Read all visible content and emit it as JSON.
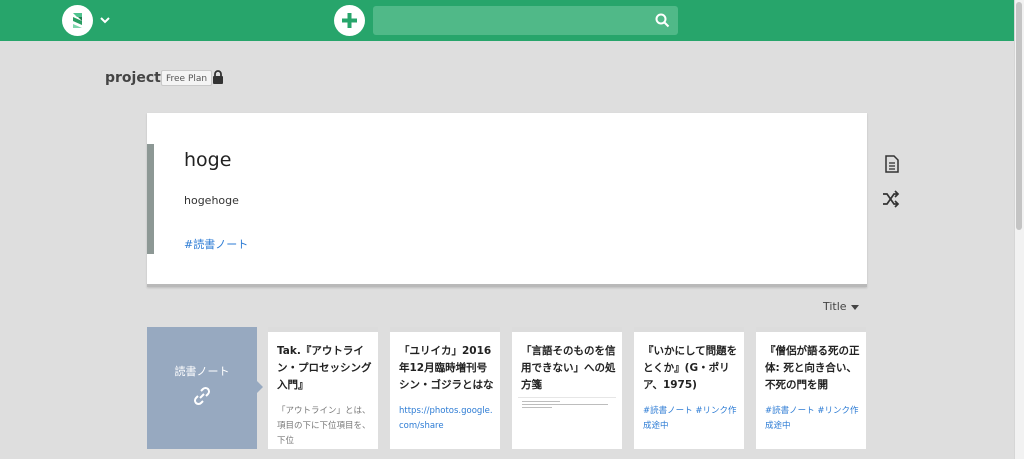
{
  "header": {
    "search": {
      "placeholder": "",
      "value": ""
    },
    "colors": {
      "bar": "#27a56b",
      "search_bg": "#50b988"
    }
  },
  "project": {
    "name": "project",
    "plan": "Free Plan"
  },
  "page": {
    "title": "hoge",
    "body": "hogehoge",
    "tag": "#読書ノート"
  },
  "sort": {
    "label": "Title"
  },
  "tag_tile": {
    "label": "読書ノート"
  },
  "cards": [
    {
      "title": "Tak.『アウトライン・プロセッシング入門』",
      "desc": "「アウトライン」とは、項目の下に下位項目を、下位"
    },
    {
      "title": "「ユリイカ」2016年12月臨時増刊号 シン・ゴジラとはな",
      "link": "https://photos.google.com/share"
    },
    {
      "title": "「言語そのものを信用できない」への処方箋"
    },
    {
      "title": "『いかにして問題をとくか』(G・ポリア、1975)",
      "tags": "#読書ノート #リンク作成途中"
    },
    {
      "title": "『僧侶が語る死の正体: 死と向き合い、不死の門を開",
      "tags": "#読書ノート #リンク作成途中"
    }
  ]
}
